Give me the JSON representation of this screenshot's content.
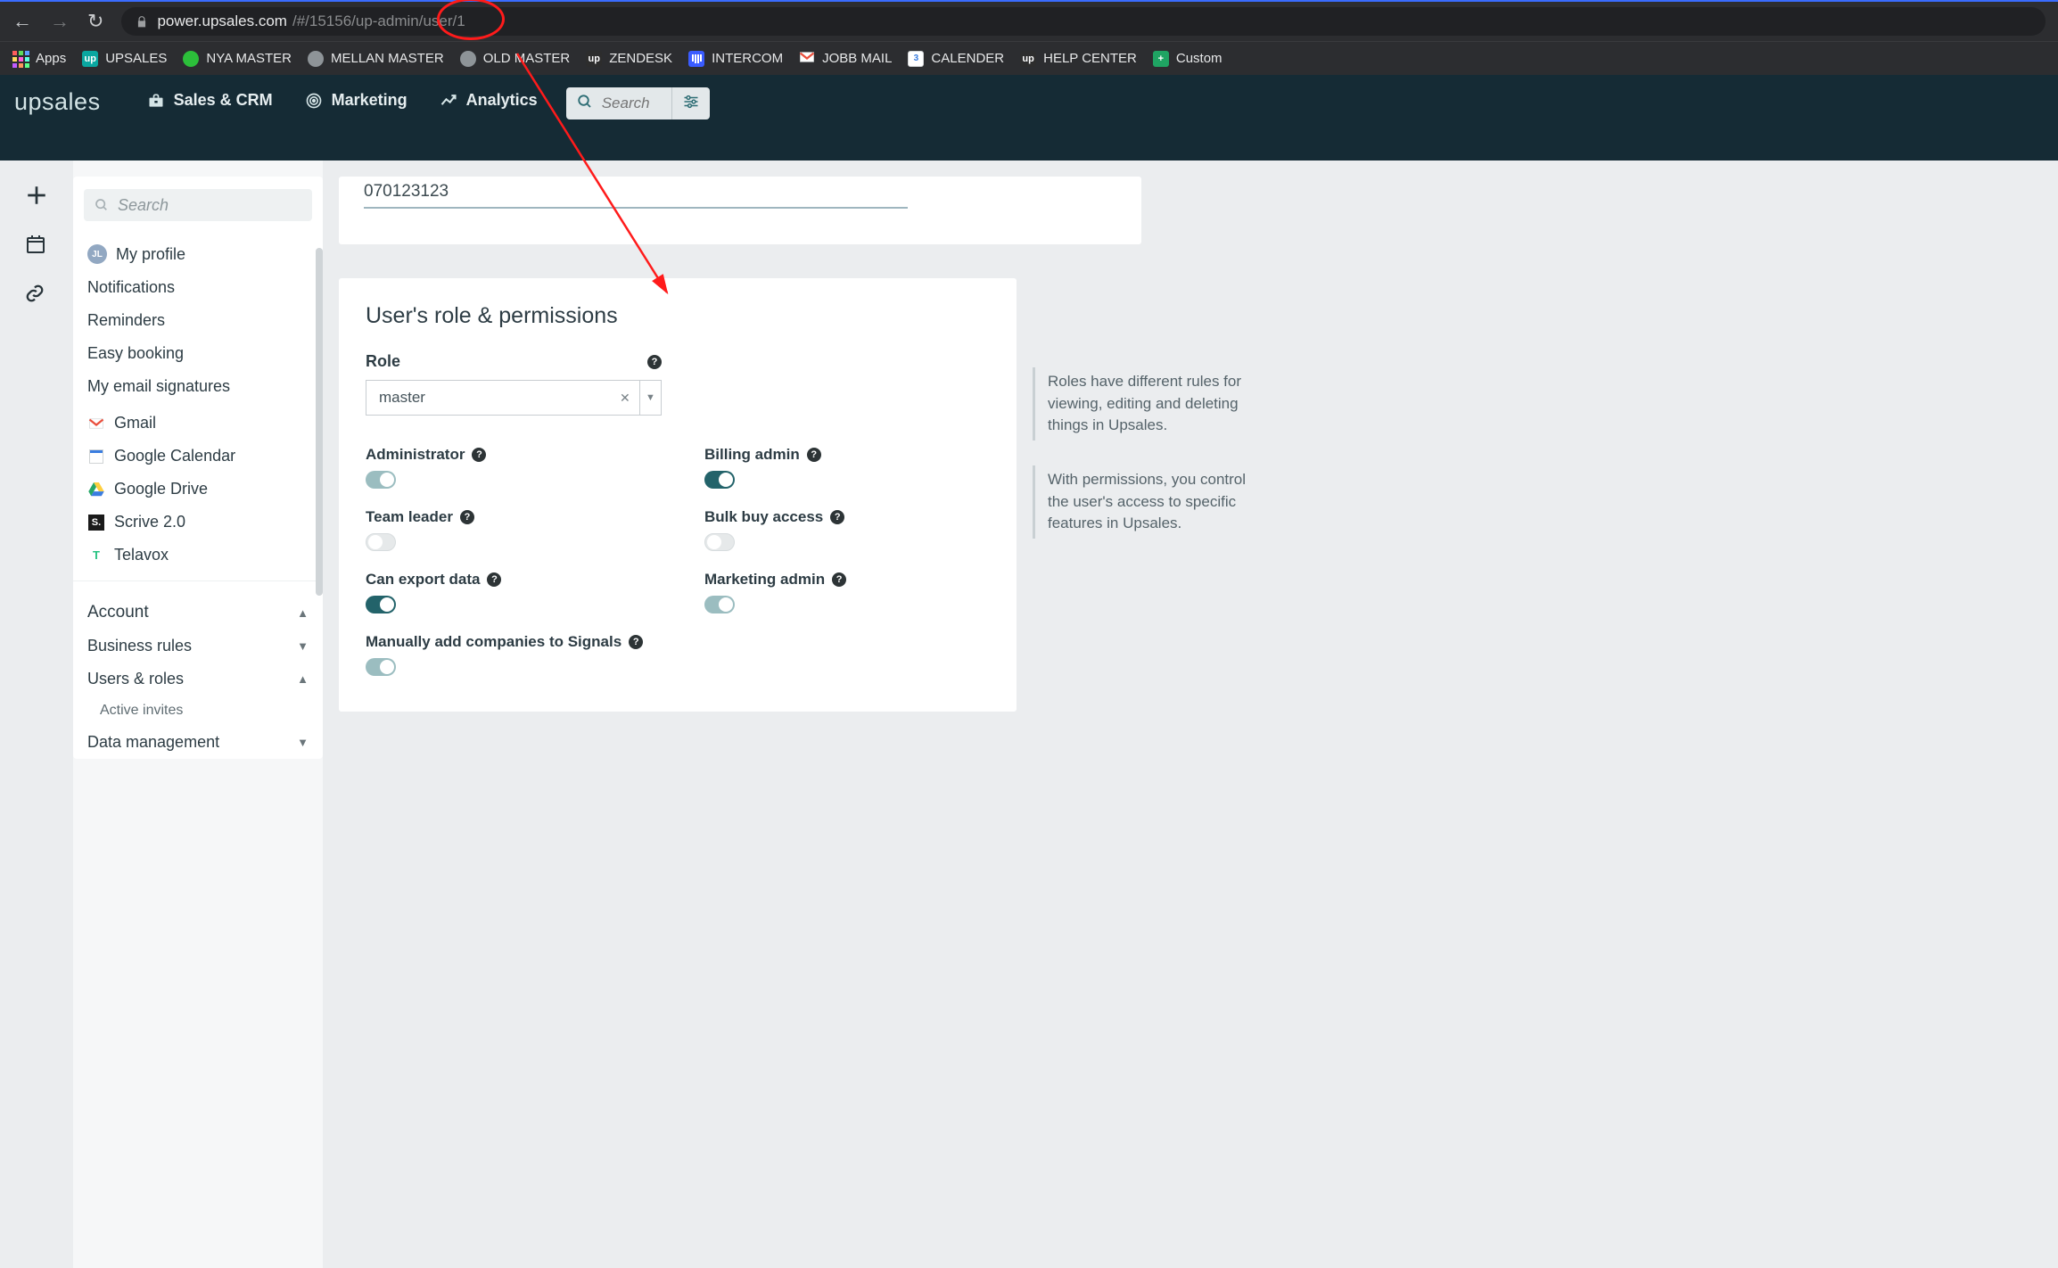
{
  "browser": {
    "url_host": "power.upsales.com",
    "url_path": "/#/15156/up-admin/user/1",
    "apps_label": "Apps",
    "bookmarks": [
      {
        "label": "UPSALES",
        "icon": "up",
        "bg": "#0aa7a0",
        "fg": "#fff"
      },
      {
        "label": "NYA MASTER",
        "icon": "globe-green"
      },
      {
        "label": "MELLAN MASTER",
        "icon": "globe-grey"
      },
      {
        "label": "OLD MASTER",
        "icon": "globe-grey"
      },
      {
        "label": "ZENDESK",
        "icon": "up",
        "bg": "#2d2d2d",
        "fg": "#fff"
      },
      {
        "label": "INTERCOM",
        "icon": "intercom"
      },
      {
        "label": "JOBB MAIL",
        "icon": "gmail"
      },
      {
        "label": "CALENDER",
        "icon": "cal3"
      },
      {
        "label": "HELP CENTER",
        "icon": "up",
        "bg": "#2d2d2d",
        "fg": "#fff"
      },
      {
        "label": "Custom",
        "icon": "sheets"
      }
    ]
  },
  "nav": {
    "logo": "upsales",
    "items": [
      {
        "label": "Sales & CRM",
        "icon": "briefcase"
      },
      {
        "label": "Marketing",
        "icon": "target"
      },
      {
        "label": "Analytics",
        "icon": "chart"
      }
    ],
    "search_placeholder": "Search"
  },
  "sidebar": {
    "search_placeholder": "Search",
    "profile_label": "My profile",
    "profile_initials": "JL",
    "items": [
      "Notifications",
      "Reminders",
      "Easy booking",
      "My email signatures"
    ],
    "integrations": [
      {
        "label": "Gmail",
        "icon": "gmail"
      },
      {
        "label": "Google Calendar",
        "icon": "gcal"
      },
      {
        "label": "Google Drive",
        "icon": "gdrive"
      },
      {
        "label": "Scrive 2.0",
        "icon": "scrive"
      },
      {
        "label": "Telavox",
        "icon": "telavox"
      }
    ],
    "account_label": "Account",
    "account_items": [
      {
        "label": "Business rules",
        "chev": "down"
      },
      {
        "label": "Users & roles",
        "chev": "up"
      },
      {
        "label": "Active invites",
        "indent": true
      },
      {
        "label": "Data management",
        "chev": "down"
      }
    ]
  },
  "content": {
    "phone_value": "070123123",
    "perm_title": "User's role & permissions",
    "role_label": "Role",
    "role_value": "master",
    "toggles": [
      {
        "key": "administrator",
        "label": "Administrator",
        "state": "on-light"
      },
      {
        "key": "billing_admin",
        "label": "Billing admin",
        "state": "on"
      },
      {
        "key": "team_leader",
        "label": "Team leader",
        "state": "off"
      },
      {
        "key": "bulk_buy",
        "label": "Bulk buy access",
        "state": "off"
      },
      {
        "key": "can_export",
        "label": "Can export data",
        "state": "on"
      },
      {
        "key": "marketing_admin",
        "label": "Marketing admin",
        "state": "on-light"
      },
      {
        "key": "signals",
        "label": "Manually add companies to Signals",
        "state": "on-light",
        "full": true
      }
    ],
    "info1": "Roles have different rules for viewing, editing and deleting things in Upsales.",
    "info2": "With permissions, you control the user's access to specific features in Upsales."
  }
}
